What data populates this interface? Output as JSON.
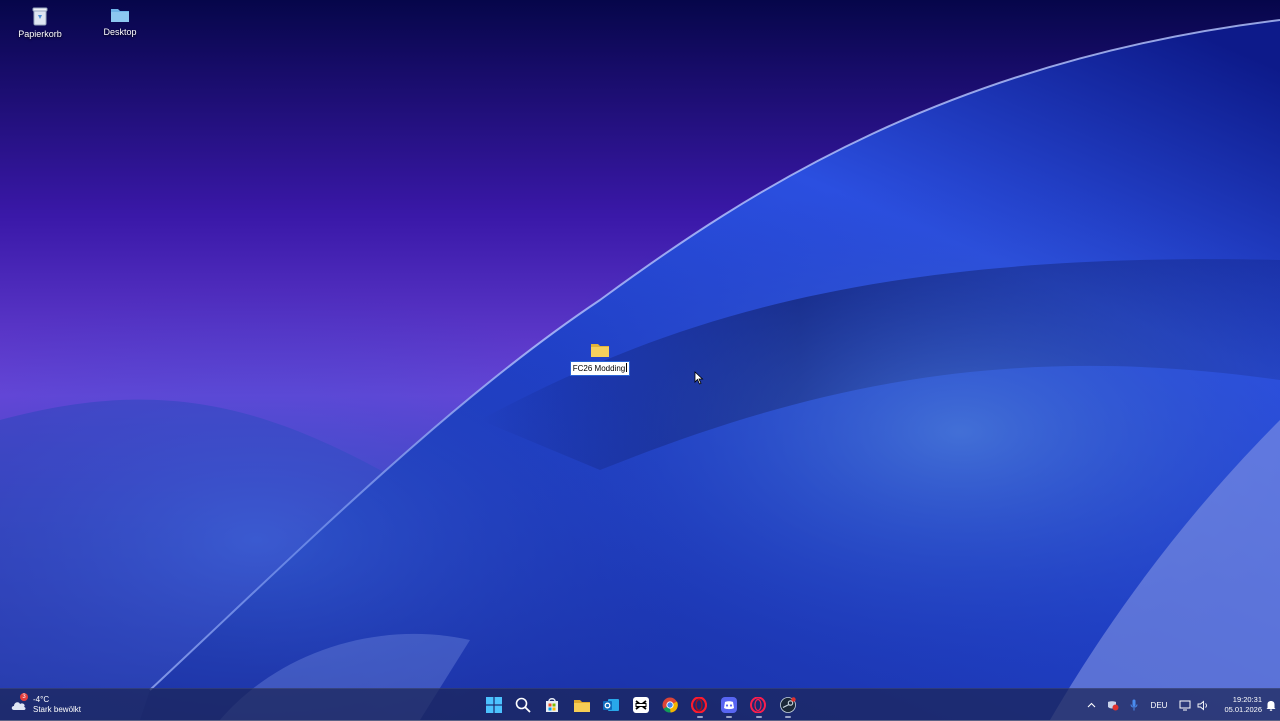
{
  "desktop": {
    "icons": [
      {
        "label": "Papierkorb",
        "icon": "recycle-bin-icon"
      },
      {
        "label": "Desktop",
        "icon": "folder-icon"
      }
    ],
    "renaming_folder": {
      "label": "FC26 Modding",
      "icon": "folder-icon",
      "state": "renaming"
    }
  },
  "taskbar": {
    "weather": {
      "temperature": "-4°C",
      "condition": "Stark bewölkt",
      "badge": "3",
      "icon": "weather-cloud-icon"
    },
    "apps": [
      {
        "name": "start",
        "icon": "windows-start-icon",
        "running": false
      },
      {
        "name": "search",
        "icon": "search-icon",
        "running": false
      },
      {
        "name": "store",
        "icon": "store-icon",
        "running": false
      },
      {
        "name": "file-explorer",
        "icon": "folder-icon",
        "running": false
      },
      {
        "name": "outlook",
        "icon": "outlook-icon",
        "running": false
      },
      {
        "name": "capcut",
        "icon": "capcut-icon",
        "running": false
      },
      {
        "name": "chrome",
        "icon": "chrome-icon",
        "running": false
      },
      {
        "name": "opera",
        "icon": "opera-icon",
        "running": true
      },
      {
        "name": "discord",
        "icon": "discord-icon",
        "running": true
      },
      {
        "name": "opera-gx",
        "icon": "opera-gx-icon",
        "running": true
      },
      {
        "name": "steam",
        "icon": "steam-icon",
        "running": true
      }
    ],
    "tray": {
      "language": "DEU",
      "time": "19:20:31",
      "date": "05.01.2026",
      "icons": [
        "chevron-up-icon",
        "security-shield-icon",
        "microphone-icon",
        "network-icon",
        "volume-icon",
        "notification-icon"
      ]
    }
  },
  "colors": {
    "taskbar_bg": "#1c2658",
    "accent": "#2a63d6",
    "folder": "#f2c94c"
  }
}
